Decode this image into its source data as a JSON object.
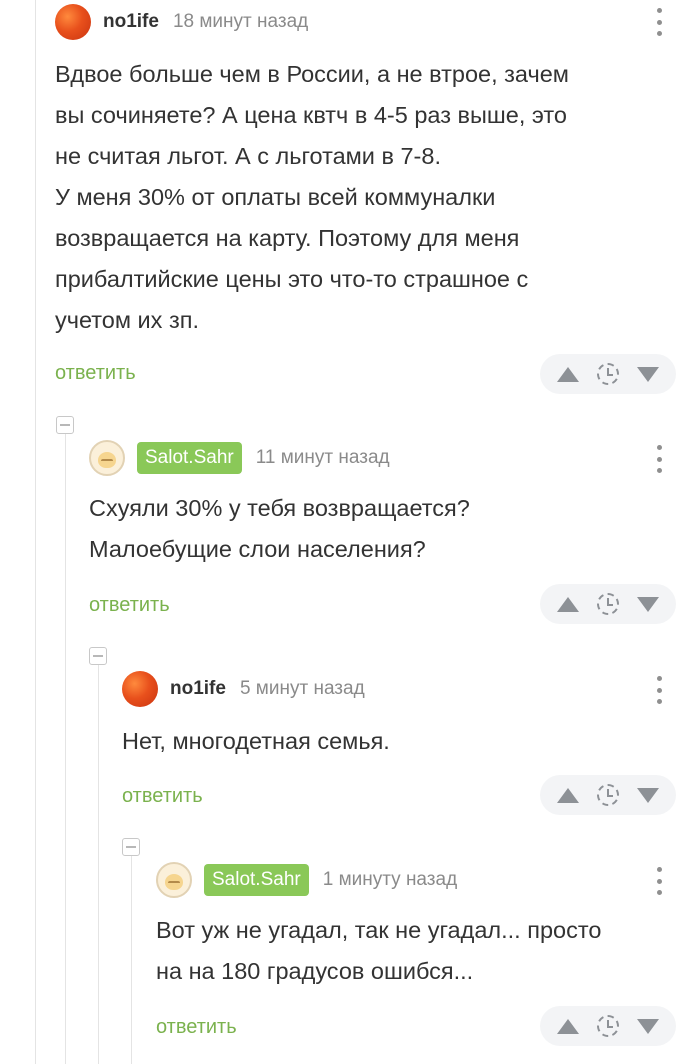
{
  "comments": [
    {
      "author": "no1ife",
      "time": "18 минут назад",
      "lines": [
        "Вдвое больше чем в России, а не втрое, зачем",
        "вы сочиняете? А цена квтч в 4-5 раз выше, это",
        "не считая льгот. А с льготами в 7-8.",
        "У меня 30% от оплаты всей коммуналки",
        "возвращается на карту. Поэтому для меня",
        "прибалтийские цены это что-то страшное с",
        "учетом их зп."
      ],
      "reply_label": "ответить",
      "avatar": "orange-sun-avatar"
    },
    {
      "author": "Salot.Sahr",
      "time": "11 минут назад",
      "lines": [
        "Схуяли 30% у тебя возвращается?",
        "Малоебущие слои населения?"
      ],
      "reply_label": "ответить",
      "avatar": "cat-avatar"
    },
    {
      "author": "no1ife",
      "time": "5 минут назад",
      "lines": [
        "Нет, многодетная семья."
      ],
      "reply_label": "ответить",
      "avatar": "orange-sun-avatar"
    },
    {
      "author": "Salot.Sahr",
      "time": "1 минуту назад",
      "lines": [
        "Вот уж не угадал, так не угадал... просто",
        "на на 180 градусов ошибся..."
      ],
      "reply_label": "ответить",
      "avatar": "cat-avatar"
    }
  ],
  "colors": {
    "accent": "#7bb24e",
    "author_badge": "#8ac858",
    "vote_bg": "#f3f4f6",
    "icon_gray": "#8d9196"
  }
}
